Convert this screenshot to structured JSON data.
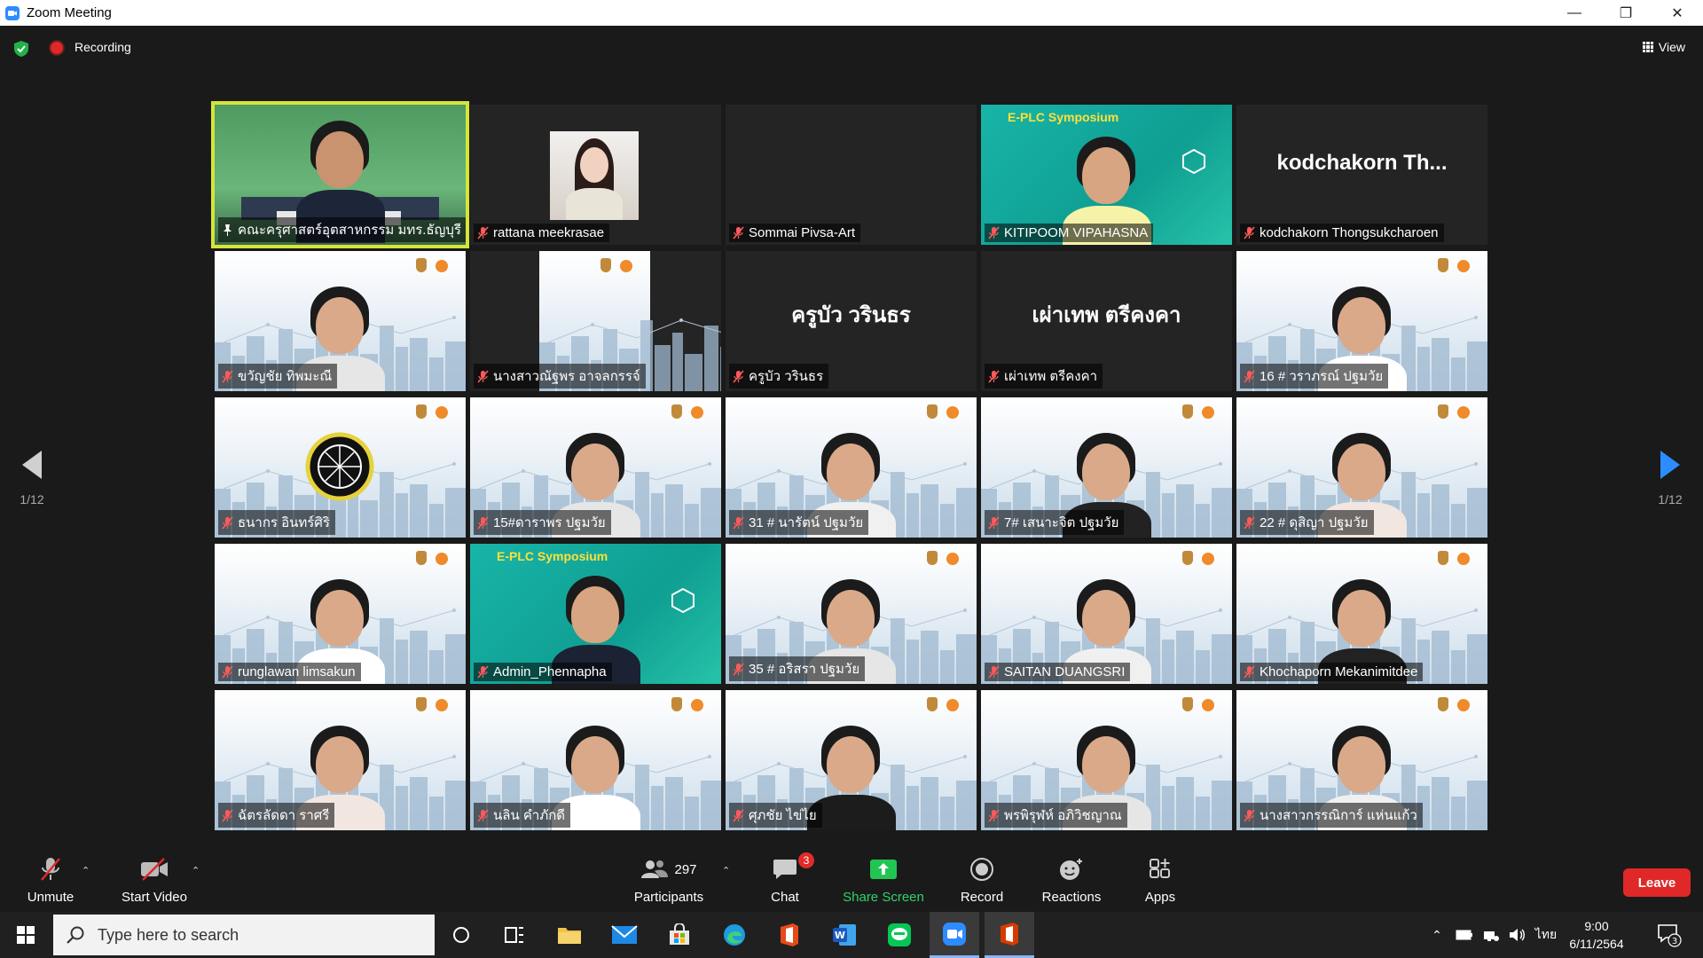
{
  "window": {
    "title": "Zoom Meeting"
  },
  "topbar": {
    "recording_label": "Recording",
    "view_label": "View"
  },
  "pager": {
    "left_label": "1/12",
    "right_label": "1/12"
  },
  "tiles": [
    {
      "name": "คณะครุศาสตร์อุตสาหกรรม มทร.ธัญบุรี",
      "type": "room"
    },
    {
      "name": "rattana meekrasae",
      "type": "photo"
    },
    {
      "name": "Sommai Pivsa-Art",
      "type": "blank"
    },
    {
      "name": "KITIPOOM VIPAHASNA",
      "type": "green",
      "overlay": "E-PLC Symposium"
    },
    {
      "name": "kodchakorn Thongsukcharoen",
      "type": "text",
      "big": "kodchakorn Th..."
    },
    {
      "name": "ขวัญชัย ทิพมะณี",
      "type": "city"
    },
    {
      "name": "นางสาวณัฐพร อาจลกรรจ์",
      "type": "citysmall"
    },
    {
      "name": "ครูบัว วรินธร",
      "type": "text",
      "big": "ครูบัว วรินธร"
    },
    {
      "name": "เผ่าเทพ ตรีคงคา",
      "type": "text",
      "big": "เผ่าเทพ ตรีคงคา"
    },
    {
      "name": "16 # วราภรณ์ ปฐมวัย",
      "type": "city"
    },
    {
      "name": "ธนากร อินทร์ศิริ",
      "type": "city"
    },
    {
      "name": "15#ดาราพร ปฐมวัย",
      "type": "city"
    },
    {
      "name": "31 # นารัตน์ ปฐมวัย",
      "type": "city"
    },
    {
      "name": "7# เสนาะจิต ปฐมวัย",
      "type": "city"
    },
    {
      "name": "22 # ดุสิญา ปฐมวัย",
      "type": "city"
    },
    {
      "name": "runglawan limsakun",
      "type": "city"
    },
    {
      "name": "Admin_Phennapha",
      "type": "green",
      "overlay": "E-PLC Symposium"
    },
    {
      "name": "35 # อริสรา ปฐมวัย",
      "type": "city"
    },
    {
      "name": "SAITAN DUANGSRI",
      "type": "city"
    },
    {
      "name": "Khochaporn Mekanimitdee",
      "type": "city"
    },
    {
      "name": "ฉัตรลัดดา ราศรี",
      "type": "city"
    },
    {
      "name": "นลิน คำภักดี",
      "type": "city"
    },
    {
      "name": "ศุภชัย ไข่ไย",
      "type": "city"
    },
    {
      "name": "พรพิรุฬห์ อภิวิชญาณ",
      "type": "city"
    },
    {
      "name": "นางสาวกรรณิการ์ แห่นแก้ว",
      "type": "city"
    }
  ],
  "toolbar": {
    "unmute": "Unmute",
    "start_video": "Start Video",
    "participants": "Participants",
    "participants_count": "297",
    "chat": "Chat",
    "chat_badge": "3",
    "share_screen": "Share Screen",
    "record": "Record",
    "reactions": "Reactions",
    "apps": "Apps",
    "leave": "Leave"
  },
  "taskbar": {
    "search_placeholder": "Type here to search",
    "language": "ไทย",
    "time": "9:00",
    "date": "6/11/2564",
    "notification_count": "3"
  },
  "colors": {
    "accent_green": "#2fd36b",
    "leave_red": "#e02828",
    "active_speaker": "#d6e43a",
    "zoom_blue": "#2d8cff"
  }
}
